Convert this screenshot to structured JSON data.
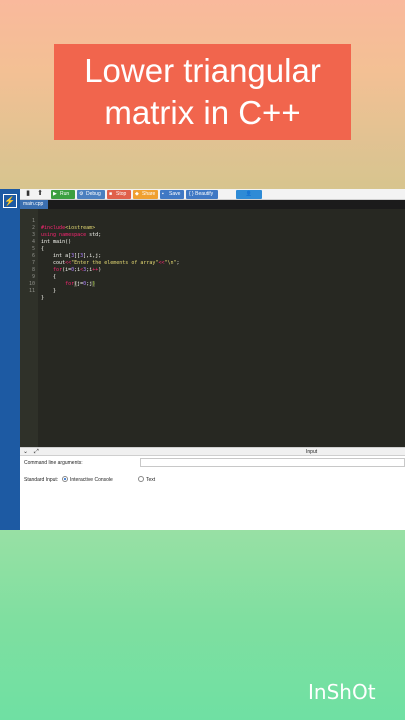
{
  "overlay": {
    "title_line1": "Lower triangular",
    "title_line2": "matrix in C++",
    "watermark": "InShOt"
  },
  "toolbar": {
    "run": "Run",
    "debug": "Debug",
    "stop": "Stop",
    "share": "Share",
    "save": "Save",
    "beautify": "{ } Beautify"
  },
  "colors": {
    "run": "#3c9f40",
    "debug": "#4a7fbf",
    "stop": "#e0604a",
    "share": "#f0a030",
    "save": "#3f78c4",
    "beautify": "#3f78c4",
    "user": "#2e8bd6"
  },
  "file_tab": "main.cpp",
  "editor": {
    "line_numbers": [
      "1",
      "2",
      "3",
      "4",
      "5",
      "6",
      "7",
      "8",
      "9",
      "10",
      "11"
    ]
  },
  "panel": {
    "input_tab": "Input",
    "cmd_label": "Command line arguments:",
    "std_label": "Standard Input:",
    "option_interactive": "Interactive Console",
    "option_text": "Text"
  }
}
